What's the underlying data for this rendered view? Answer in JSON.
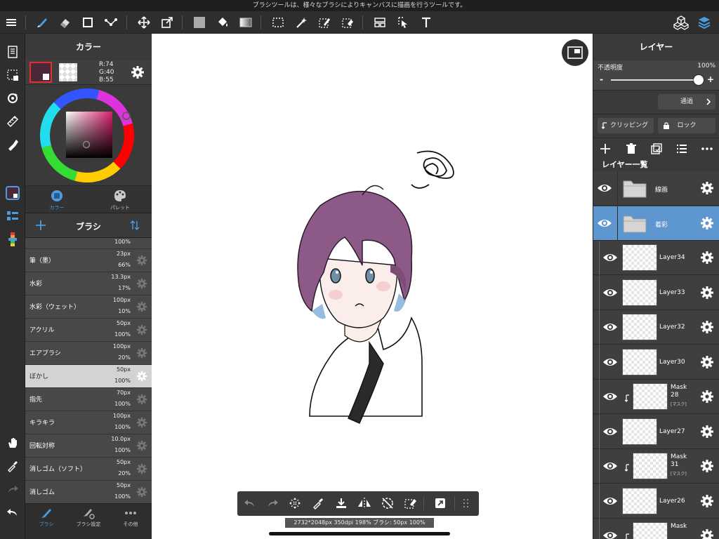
{
  "hint": "ブラシツールは、様々なブラシによりキャンバスに描画を行うツールです。",
  "colors": {
    "accent": "#5e96cf",
    "current_color": "#4A2837",
    "selected_row": "#d3d3d3"
  },
  "color_panel": {
    "title": "カラー",
    "rgb": {
      "r": "R:74",
      "g": "G:40",
      "b": "B:55"
    },
    "tabs": [
      "カラー",
      "パレット"
    ]
  },
  "brush_panel": {
    "title": "ブラシ",
    "partial_top": {
      "opacity": "100%"
    },
    "items": [
      {
        "name": "筆（墨）",
        "size": "23px",
        "opacity": "66%"
      },
      {
        "name": "水彩",
        "size": "13.3px",
        "opacity": "17%"
      },
      {
        "name": "水彩（ウェット）",
        "size": "100px",
        "opacity": "10%"
      },
      {
        "name": "アクリル",
        "size": "50px",
        "opacity": "100%"
      },
      {
        "name": "エアブラシ",
        "size": "100px",
        "opacity": "20%"
      },
      {
        "name": "ぼかし",
        "size": "50px",
        "opacity": "100%",
        "selected": true
      },
      {
        "name": "指先",
        "size": "70px",
        "opacity": "100%"
      },
      {
        "name": "キラキラ",
        "size": "100px",
        "opacity": "100%"
      },
      {
        "name": "回転対称",
        "size": "10.0px",
        "opacity": "100%"
      },
      {
        "name": "消しゴム（ソフト）",
        "size": "50px",
        "opacity": "20%"
      },
      {
        "name": "消しゴム",
        "size": "50px",
        "opacity": "100%"
      }
    ]
  },
  "bottom_tabs": [
    "ブラシ",
    "ブラシ設定",
    "その他"
  ],
  "status_info": "2732*2048px 350dpi 198% ブラシ: 50px 100%",
  "layer_panel": {
    "title": "レイヤー",
    "opacity_label": "不透明度",
    "opacity_value": "100%",
    "opacity_level": 1.0,
    "minus": "-",
    "plus": "+",
    "blend_mode": "通過",
    "clipping_label": "クリッピング",
    "lock_label": "ロック",
    "list_title": "レイヤー一覧",
    "layers": [
      {
        "name": "線画",
        "type": "folder"
      },
      {
        "name": "着彩",
        "type": "folder",
        "selected": true
      },
      {
        "name": "Layer34",
        "type": "layer"
      },
      {
        "name": "Layer33",
        "type": "layer"
      },
      {
        "name": "Layer32",
        "type": "layer"
      },
      {
        "name": "Layer30",
        "type": "layer"
      },
      {
        "name": "Mask\n28",
        "type": "mask",
        "sub": "[マスク]"
      },
      {
        "name": "Layer27",
        "type": "layer"
      },
      {
        "name": "Mask\n31",
        "type": "mask",
        "sub": "[マスク]"
      },
      {
        "name": "Layer26",
        "type": "layer"
      },
      {
        "name": "Mask",
        "type": "mask",
        "sub": ""
      }
    ]
  }
}
